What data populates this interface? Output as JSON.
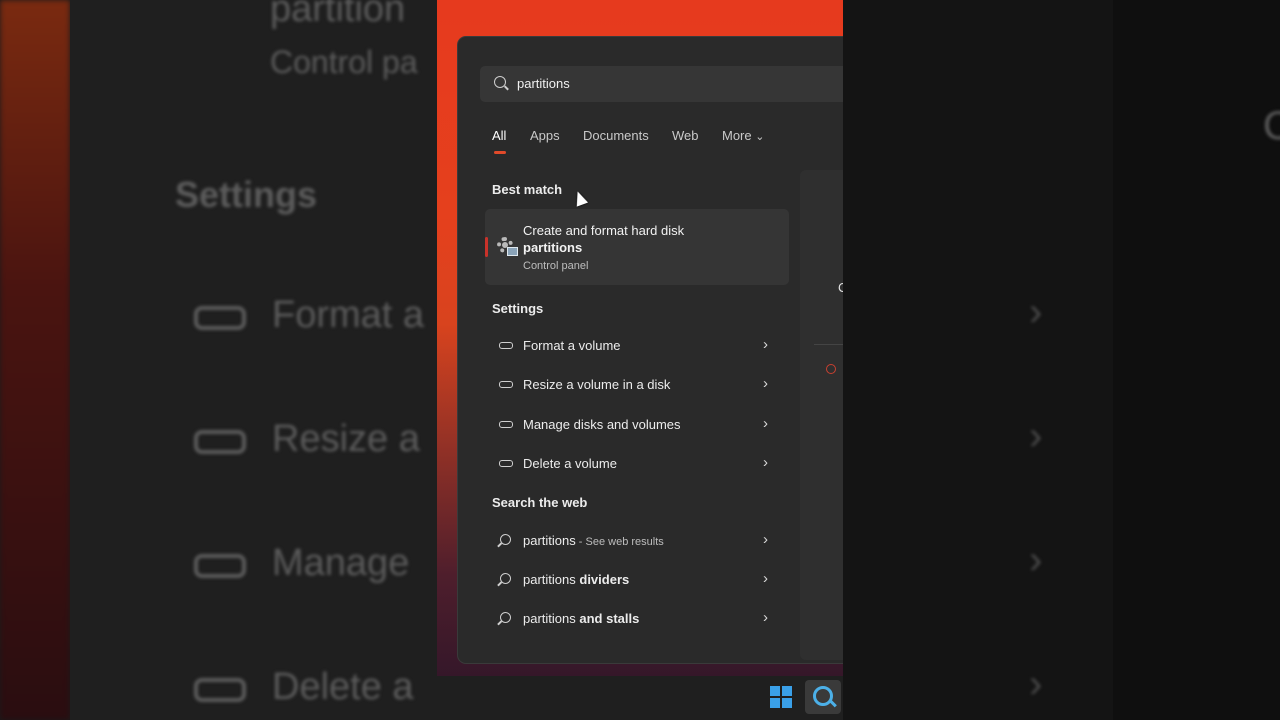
{
  "background": {
    "left_items": [
      "Format a",
      "Resize a",
      "Manage",
      "Delete a"
    ],
    "left_heading": "Settings",
    "left_top_title": "partition",
    "left_top_sub": "Control pa",
    "right_peek": "C"
  },
  "search": {
    "query": "partitions"
  },
  "tabs": [
    "All",
    "Apps",
    "Documents",
    "Web",
    "More"
  ],
  "more_chevron": "⌄",
  "best_match": {
    "heading": "Best match",
    "title": "Create and format hard disk",
    "bold": "partitions",
    "subtitle": "Control panel",
    "icon": "disk-management-gear-icon"
  },
  "settings": {
    "heading": "Settings",
    "items": [
      "Format a volume",
      "Resize a volume in a disk",
      "Manage disks and volumes",
      "Delete a volume"
    ]
  },
  "web": {
    "heading": "Search the web",
    "items": [
      {
        "plain": "partitions",
        "bold": "",
        "suffix": " - See web results"
      },
      {
        "plain": "partitions ",
        "bold": "dividers",
        "suffix": ""
      },
      {
        "plain": "partitions ",
        "bold": "and stalls",
        "suffix": ""
      }
    ]
  },
  "preview": {
    "peek": "C"
  },
  "chevron": "›",
  "colors": {
    "accent": "#e04a2a",
    "taskbar_icon": "#3aa0e8"
  }
}
